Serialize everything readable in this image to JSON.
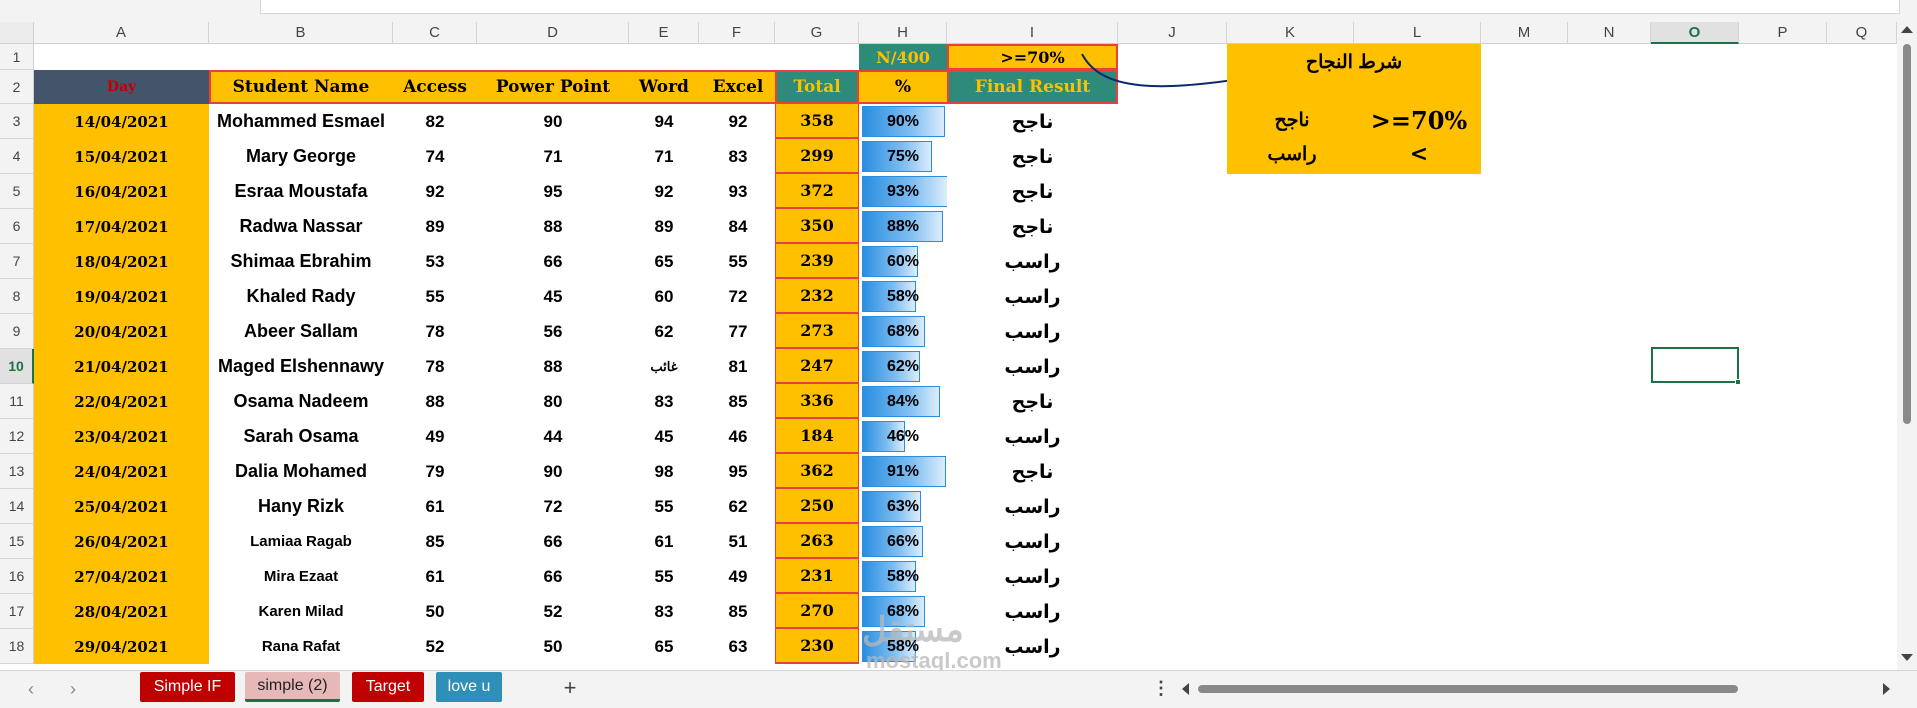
{
  "columns": [
    "A",
    "B",
    "C",
    "D",
    "E",
    "F",
    "G",
    "H",
    "I",
    "J",
    "K",
    "L",
    "M",
    "N",
    "O",
    "P",
    "Q"
  ],
  "selected_column": "O",
  "rows": [
    "1",
    "2",
    "3",
    "4",
    "5",
    "6",
    "7",
    "8",
    "9",
    "10",
    "11",
    "12",
    "13",
    "14",
    "15",
    "16",
    "17",
    "18"
  ],
  "selected_row": "10",
  "header": {
    "day": "Day",
    "student_name": "Student Name",
    "access": "Access",
    "power_point": "Power Point",
    "word": "Word",
    "excel": "Excel",
    "total": "Total",
    "percent": "%",
    "final_result": "Final Result",
    "n_over": "N/400",
    "threshold": ">=70%"
  },
  "students": [
    {
      "date": "14/04/2021",
      "name": "Mohammed Esmael",
      "access": "82",
      "pp": "90",
      "word": "94",
      "excel": "92",
      "total": "358",
      "pct": "90%",
      "pct_value": 90,
      "result": "ناجح"
    },
    {
      "date": "15/04/2021",
      "name": "Mary George",
      "access": "74",
      "pp": "71",
      "word": "71",
      "excel": "83",
      "total": "299",
      "pct": "75%",
      "pct_value": 75,
      "result": "ناجح"
    },
    {
      "date": "16/04/2021",
      "name": "Esraa Moustafa",
      "access": "92",
      "pp": "95",
      "word": "92",
      "excel": "93",
      "total": "372",
      "pct": "93%",
      "pct_value": 93,
      "result": "ناجح"
    },
    {
      "date": "17/04/2021",
      "name": "Radwa Nassar",
      "access": "89",
      "pp": "88",
      "word": "89",
      "excel": "84",
      "total": "350",
      "pct": "88%",
      "pct_value": 88,
      "result": "ناجح"
    },
    {
      "date": "18/04/2021",
      "name": "Shimaa Ebrahim",
      "access": "53",
      "pp": "66",
      "word": "65",
      "excel": "55",
      "total": "239",
      "pct": "60%",
      "pct_value": 60,
      "result": "راسب"
    },
    {
      "date": "19/04/2021",
      "name": "Khaled Rady",
      "access": "55",
      "pp": "45",
      "word": "60",
      "excel": "72",
      "total": "232",
      "pct": "58%",
      "pct_value": 58,
      "result": "راسب"
    },
    {
      "date": "20/04/2021",
      "name": "Abeer Sallam",
      "access": "78",
      "pp": "56",
      "word": "62",
      "excel": "77",
      "total": "273",
      "pct": "68%",
      "pct_value": 68,
      "result": "راسب"
    },
    {
      "date": "21/04/2021",
      "name": "Maged Elshennawy",
      "access": "78",
      "pp": "88",
      "word": "غائب",
      "excel": "81",
      "total": "247",
      "pct": "62%",
      "pct_value": 62,
      "result": "راسب"
    },
    {
      "date": "22/04/2021",
      "name": "Osama Nadeem",
      "access": "88",
      "pp": "80",
      "word": "83",
      "excel": "85",
      "total": "336",
      "pct": "84%",
      "pct_value": 84,
      "result": "ناجح"
    },
    {
      "date": "23/04/2021",
      "name": "Sarah Osama",
      "access": "49",
      "pp": "44",
      "word": "45",
      "excel": "46",
      "total": "184",
      "pct": "46%",
      "pct_value": 46,
      "result": "راسب"
    },
    {
      "date": "24/04/2021",
      "name": "Dalia Mohamed",
      "access": "79",
      "pp": "90",
      "word": "98",
      "excel": "95",
      "total": "362",
      "pct": "91%",
      "pct_value": 91,
      "result": "ناجح"
    },
    {
      "date": "25/04/2021",
      "name": "Hany Rizk",
      "access": "61",
      "pp": "72",
      "word": "55",
      "excel": "62",
      "total": "250",
      "pct": "63%",
      "pct_value": 63,
      "result": "راسب"
    },
    {
      "date": "26/04/2021",
      "name": "Lamiaa Ragab",
      "access": "85",
      "pp": "66",
      "word": "61",
      "excel": "51",
      "total": "263",
      "pct": "66%",
      "pct_value": 66,
      "result": "راسب"
    },
    {
      "date": "27/04/2021",
      "name": "Mira Ezaat",
      "access": "61",
      "pp": "66",
      "word": "55",
      "excel": "49",
      "total": "231",
      "pct": "58%",
      "pct_value": 58,
      "result": "راسب"
    },
    {
      "date": "28/04/2021",
      "name": "Karen Milad",
      "access": "50",
      "pp": "52",
      "word": "83",
      "excel": "85",
      "total": "270",
      "pct": "68%",
      "pct_value": 68,
      "result": "راسب"
    },
    {
      "date": "29/04/2021",
      "name": "Rana Rafat",
      "access": "52",
      "pp": "50",
      "word": "65",
      "excel": "63",
      "total": "230",
      "pct": "58%",
      "pct_value": 58,
      "result": "راسب"
    }
  ],
  "legend": {
    "title": "شرط النجاح",
    "pass_label": "ناجح",
    "pass_cond": ">=70%",
    "fail_label": "راسب",
    "fail_cond": "<"
  },
  "sheet_tabs": [
    {
      "label": "Simple IF",
      "color": "#c00000"
    },
    {
      "label": "simple (2)",
      "color": "#e6b9b8"
    },
    {
      "label": "Target",
      "color": "#c00000"
    },
    {
      "label": "love u",
      "color": "#2e8fb8"
    }
  ],
  "add_sheet": "+",
  "watermark": {
    "text1": "مستقل",
    "text2": "mostaql.com"
  },
  "colors": {
    "gold": "#ffc000",
    "teal": "#2e8b7a",
    "navy": "#44546a",
    "red": "#c00000",
    "excel_green": "#1e7145"
  }
}
